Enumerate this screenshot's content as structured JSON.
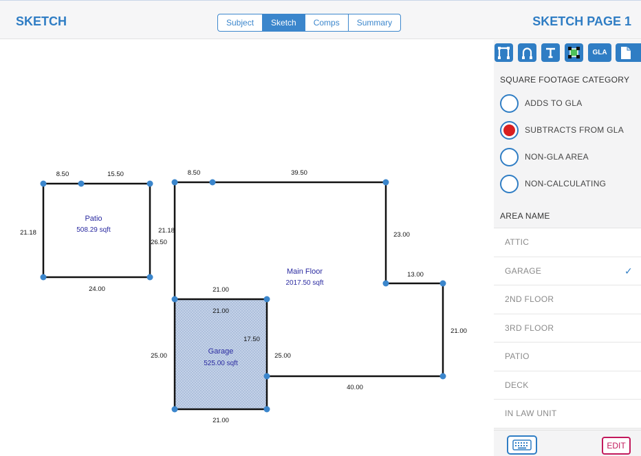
{
  "header": {
    "app_title": "SKETCH",
    "page_title": "SKETCH PAGE 1",
    "tabs": [
      {
        "label": "Subject",
        "active": false
      },
      {
        "label": "Sketch",
        "active": true
      },
      {
        "label": "Comps",
        "active": false
      },
      {
        "label": "Summary",
        "active": false
      }
    ]
  },
  "colors": {
    "accent": "#2f7dc4",
    "selected_radio": "#d81f1f",
    "edit": "#c2185b",
    "area_label": "#2a2aa0",
    "garage_fill": "#c7d5ea"
  },
  "sketch": {
    "areas": {
      "patio": {
        "name": "Patio",
        "sqft": "508.29 sqft"
      },
      "main": {
        "name": "Main Floor",
        "sqft": "2017.50 sqft"
      },
      "garage": {
        "name": "Garage",
        "sqft": "525.00 sqft"
      }
    },
    "dims": {
      "patio_top_left": "8.50",
      "patio_top_right": "15.50",
      "patio_left": "21.18",
      "patio_right": "21.18",
      "patio_bottom": "24.00",
      "main_top_left": "8.50",
      "main_top": "39.50",
      "main_left": "26.50",
      "main_right_upper": "23.00",
      "main_step": "13.00",
      "main_right_lower": "21.00",
      "main_bottom": "40.00",
      "main_over_garage": "21.00",
      "main_garage_side": "25.00",
      "garage_top": "21.00",
      "garage_left": "25.00",
      "garage_right": "17.50",
      "garage_bottom": "21.00"
    }
  },
  "panel": {
    "tools": [
      "line-tool-icon",
      "arc-tool-icon",
      "text-tool-icon",
      "area-tool-icon",
      "GLA",
      "page-icon"
    ],
    "gla_label": "GLA",
    "category_title": "SQUARE FOOTAGE CATEGORY",
    "categories": [
      {
        "label": "ADDS TO GLA",
        "selected": false
      },
      {
        "label": "SUBTRACTS FROM GLA",
        "selected": true
      },
      {
        "label": "NON-GLA AREA",
        "selected": false
      },
      {
        "label": "NON-CALCULATING",
        "selected": false
      }
    ],
    "area_name_title": "AREA NAME",
    "area_names": [
      {
        "label": "ATTIC",
        "checked": false
      },
      {
        "label": "GARAGE",
        "checked": true
      },
      {
        "label": "2ND FLOOR",
        "checked": false
      },
      {
        "label": "3RD FLOOR",
        "checked": false
      },
      {
        "label": "PATIO",
        "checked": false
      },
      {
        "label": "DECK",
        "checked": false
      },
      {
        "label": "IN LAW UNIT",
        "checked": false
      }
    ],
    "check_glyph": "✓",
    "edit_label": "EDIT"
  }
}
